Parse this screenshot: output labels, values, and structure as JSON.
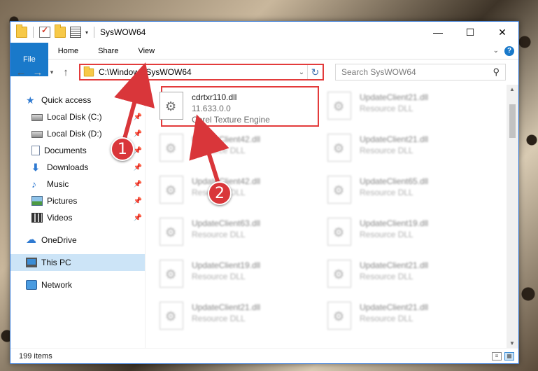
{
  "window": {
    "title": "SysWOW64",
    "controls": {
      "minimize": "—",
      "maximize": "☐",
      "close": "✕"
    }
  },
  "ribbon": {
    "tabs": [
      "File",
      "Home",
      "Share",
      "View"
    ]
  },
  "nav": {
    "back": "←",
    "forward": "→",
    "recent": "▾",
    "up": "↑"
  },
  "address": {
    "path": "C:\\Windows\\SysWOW64",
    "refresh": "↻"
  },
  "search": {
    "placeholder": "Search SysWOW64",
    "icon": "⚲"
  },
  "sidebar": {
    "quick_access": "Quick access",
    "items": [
      {
        "label": "Local Disk (C:)",
        "icon": "drive-icon",
        "pinned": true
      },
      {
        "label": "Local Disk (D:)",
        "icon": "drive-icon",
        "pinned": true
      },
      {
        "label": "Documents",
        "icon": "documents-icon",
        "pinned": true
      },
      {
        "label": "Downloads",
        "icon": "downloads-icon",
        "pinned": true
      },
      {
        "label": "Music",
        "icon": "music-icon",
        "pinned": true
      },
      {
        "label": "Pictures",
        "icon": "pictures-icon",
        "pinned": true
      },
      {
        "label": "Videos",
        "icon": "videos-icon",
        "pinned": true
      }
    ],
    "onedrive": "OneDrive",
    "this_pc": "This PC",
    "network": "Network"
  },
  "files": [
    {
      "name": "cdrtxr110.dll",
      "version": "11.633.0.0",
      "description": "Corel Texture Engine",
      "highlighted": true
    },
    {
      "name": "UpdateClient21.dll",
      "description": "Resource DLL"
    },
    {
      "name": "UpdateClient42.dll",
      "description": "Resource DLL"
    },
    {
      "name": "UpdateClient21.dll",
      "description": "Resource DLL"
    },
    {
      "name": "UpdateClient42.dll",
      "description": "Resource DLL"
    },
    {
      "name": "UpdateClient65.dll",
      "description": "Resource DLL"
    },
    {
      "name": "UpdateClient63.dll",
      "description": "Resource DLL"
    },
    {
      "name": "UpdateClient19.dll",
      "description": "Resource DLL"
    },
    {
      "name": "UpdateClient19.dll",
      "description": "Resource DLL"
    },
    {
      "name": "UpdateClient21.dll",
      "description": "Resource DLL"
    },
    {
      "name": "UpdateClient21.dll",
      "description": "Resource DLL"
    },
    {
      "name": "UpdateClient21.dll",
      "description": "Resource DLL"
    }
  ],
  "status": {
    "item_count": "199 items"
  },
  "callouts": [
    "1",
    "2"
  ],
  "colors": {
    "accent": "#1979ca",
    "highlight_box": "#e33b3b",
    "callout": "#d9363a",
    "selection": "#cce4f7"
  }
}
